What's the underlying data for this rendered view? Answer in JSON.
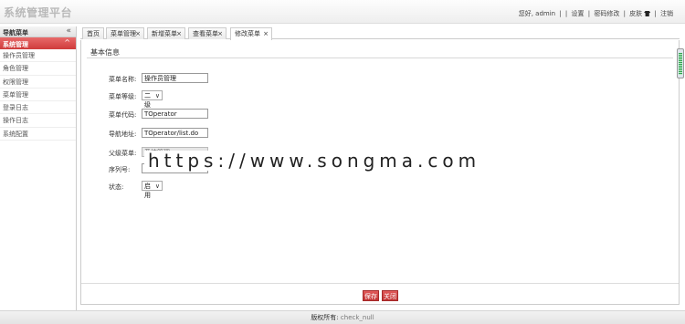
{
  "header": {
    "app_title": "系统管理平台",
    "greeting": "您好, admin",
    "links": [
      "设置",
      "密码修改",
      "皮肤",
      "注销"
    ],
    "separator": "|"
  },
  "sidebar": {
    "title": "导航菜单",
    "collapse_glyph": "«",
    "group": {
      "label": "系统管理",
      "glyph": "^"
    },
    "items": [
      "操作员管理",
      "角色管理",
      "权限管理",
      "菜单管理",
      "登录日志",
      "操作日志",
      "系统配置"
    ]
  },
  "tabs": [
    {
      "label": "首页",
      "closable": false
    },
    {
      "label": "菜单管理",
      "closable": true
    },
    {
      "label": "新增菜单",
      "closable": true
    },
    {
      "label": "查看菜单",
      "closable": true
    },
    {
      "label": "修改菜单",
      "closable": true,
      "active": true
    }
  ],
  "close_glyph": "×",
  "form": {
    "section_title": "基本信息",
    "fields": {
      "name": {
        "label": "菜单名称:",
        "value": "操作员管理"
      },
      "level": {
        "label": "菜单等级:",
        "value": "二级"
      },
      "code": {
        "label": "菜单代码:",
        "value": "TOperator"
      },
      "url": {
        "label": "导航地址:",
        "value": "TOperator/list.do"
      },
      "parent": {
        "label": "父级菜单:",
        "value": "系统管理"
      },
      "order": {
        "label": "序列号:",
        "value": ""
      },
      "status": {
        "label": "状态:",
        "value": "启用"
      }
    },
    "caret": "∨"
  },
  "actions": {
    "save": "保存",
    "close": "关闭"
  },
  "footer": {
    "label": "版权所有:",
    "value": "check_null"
  },
  "overlay": {
    "watermark": "https://www.songma.com"
  },
  "colors": {
    "accent": "#cf3b3b",
    "sidebar_group": "#d94848"
  }
}
